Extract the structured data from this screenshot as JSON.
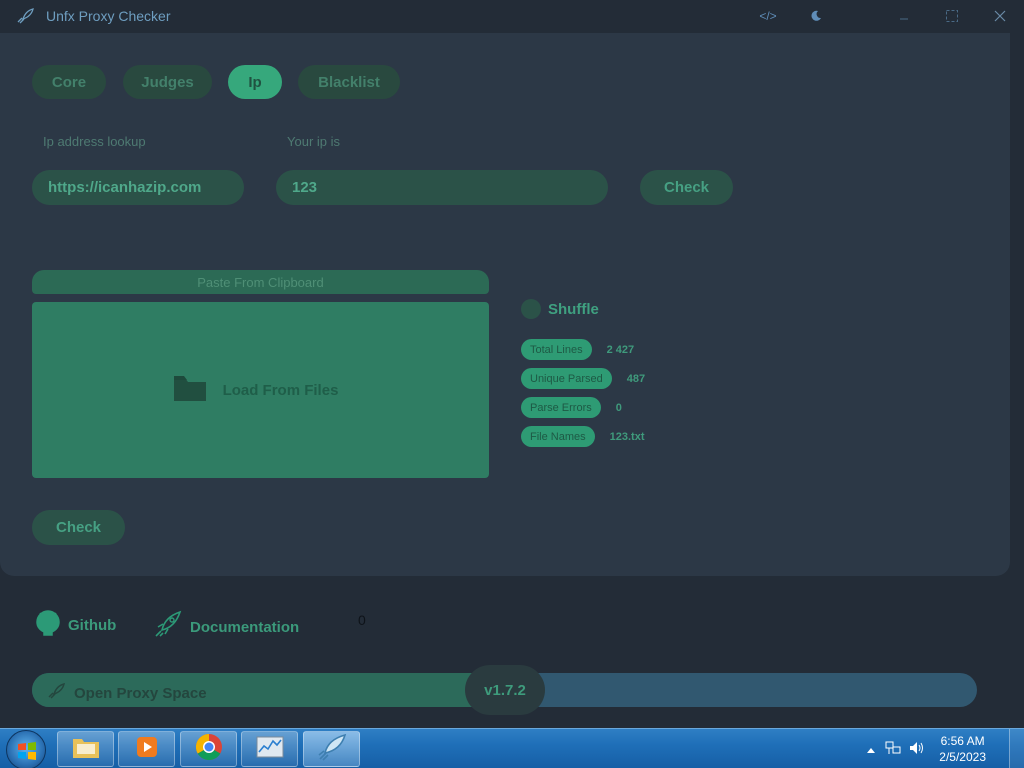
{
  "window": {
    "title": "Unfx Proxy Checker",
    "buttons": [
      "code",
      "theme",
      "minimize",
      "maximize",
      "close"
    ]
  },
  "tabs": [
    {
      "label": "Core",
      "active": false
    },
    {
      "label": "Judges",
      "active": false
    },
    {
      "label": "Ip",
      "active": true
    },
    {
      "label": "Blacklist",
      "active": false
    }
  ],
  "ip": {
    "lookup_label": "Ip address lookup",
    "lookup_value": "https://icanhazip.com",
    "your_ip_label": "Your ip is",
    "your_ip_value": "123",
    "check_label": "Check"
  },
  "input": {
    "clipboard_label": "Paste From Clipboard",
    "files_label": "Load From Files",
    "shuffle_label": "Shuffle",
    "shuffle_checked": false
  },
  "stats": [
    {
      "label": "Total Lines",
      "value": "2 427"
    },
    {
      "label": "Unique Parsed",
      "value": "487"
    },
    {
      "label": "Parse Errors",
      "value": "0"
    },
    {
      "label": "File Names",
      "value": "123.txt"
    }
  ],
  "main_check_label": "Check",
  "footer": {
    "github_label": "Github",
    "docs_label": "Documentation",
    "counter": "0",
    "open_space_label": "Open Proxy Space",
    "version": "v1.7.2",
    "progress_fraction": 0.5
  },
  "taskbar": {
    "apps": [
      "windows-explorer",
      "media-player",
      "chrome",
      "performance-monitor",
      "unfx-proxy-checker"
    ],
    "time": "6:56 AM",
    "date": "2/5/2023"
  },
  "colors": {
    "background": "#232c37",
    "panel": "#2c3846",
    "accent": "#36a87c"
  }
}
